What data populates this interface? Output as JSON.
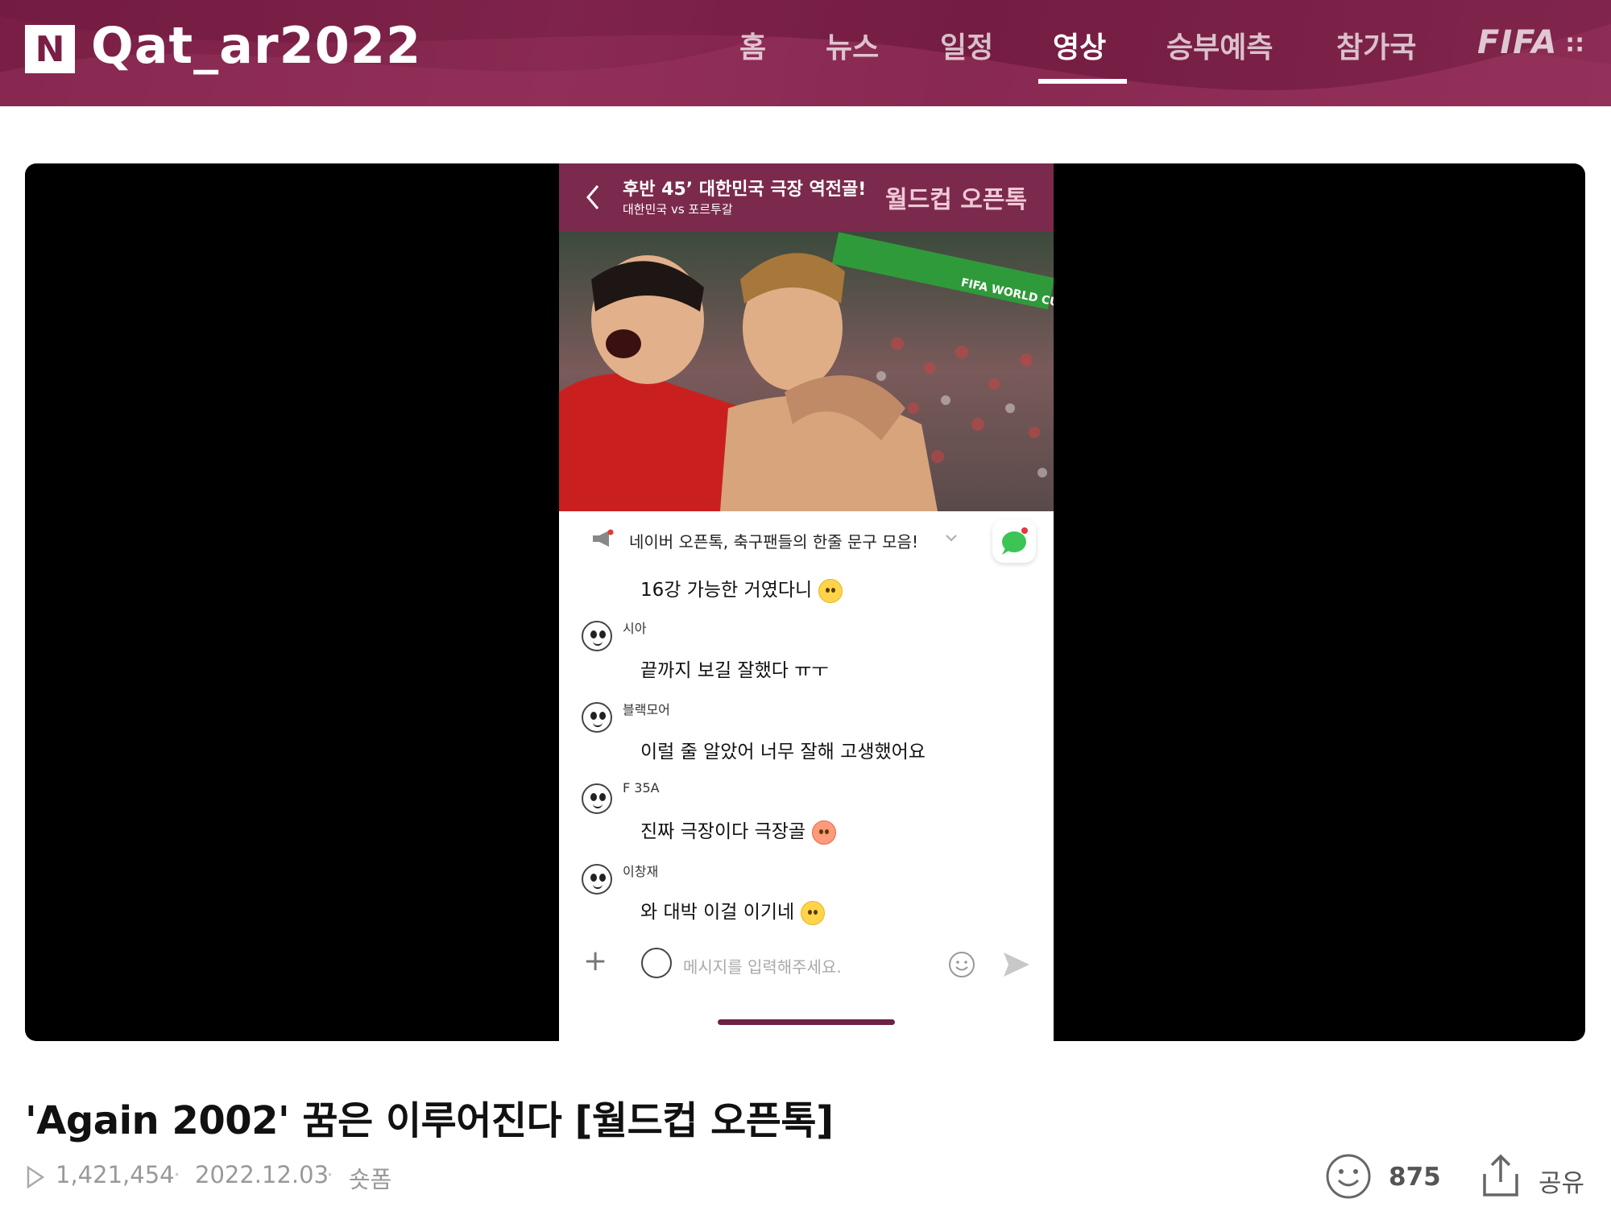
{
  "header": {
    "logo_letter": "N",
    "logo_text": "Qat_ar2022",
    "nav": [
      {
        "label": "홈"
      },
      {
        "label": "뉴스"
      },
      {
        "label": "일정"
      },
      {
        "label": "영상"
      },
      {
        "label": "승부예측"
      },
      {
        "label": "참가국"
      }
    ],
    "active_tab": "영상",
    "fifa_label": "FIFA",
    "brand_color": "#7a1e45"
  },
  "player": {
    "phone_header": {
      "title": "후반 45’ 대한민국 극장 역전골!",
      "subtitle": "대한민국 vs 포르투갈",
      "brand": "월드컵 오픈톡"
    },
    "photo_caption": "FIFA WORLD CUP Qa",
    "notice": "네이버 오픈톡, 축구팬들의 한줄 문구 모음!",
    "messages": [
      {
        "nick": "",
        "text": "16강 가능한 거였다니",
        "emoji": true
      },
      {
        "nick": "시아",
        "text": "끝까지 보길 잘했다 ㅠㅜ",
        "emoji": false
      },
      {
        "nick": "블랙모어",
        "text": "이럴 줄 알았어 너무 잘해 고생했어요",
        "emoji": false
      },
      {
        "nick": "F 35A",
        "text": "진짜 극장이다 극장골",
        "emoji": true
      },
      {
        "nick": "이창재",
        "text": "와 대박 이걸 이기네",
        "emoji": true
      }
    ],
    "input_placeholder": "메시지를 입력해주세요."
  },
  "video": {
    "title": "'Again 2002' 꿈은 이루어진다 [월드컵 오픈톡]",
    "views": "1,421,454",
    "date": "2022.12.03",
    "category": "숏폼",
    "separator": "·",
    "reaction_count": "875",
    "share_label": "공유"
  }
}
